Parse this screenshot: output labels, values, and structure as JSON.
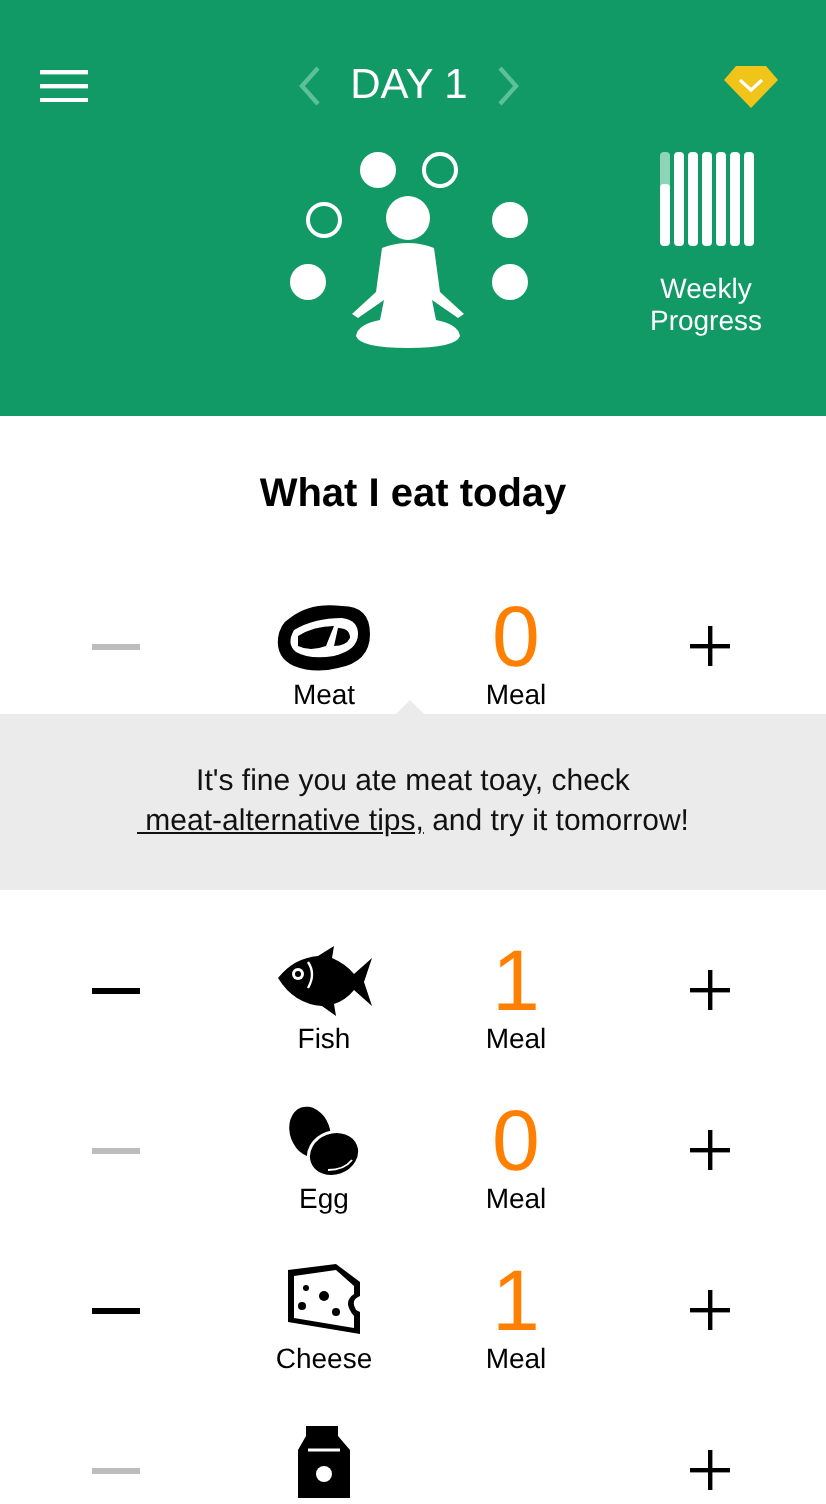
{
  "header": {
    "day": "DAY 1",
    "progress_label": "Weekly Progress",
    "meals": [
      {
        "filled": true
      },
      {
        "filled": false
      },
      {
        "filled": false
      },
      {
        "filled": true
      },
      {
        "filled": true
      },
      {
        "filled": true
      }
    ],
    "weekly_bars": [
      {
        "level": 0.66
      },
      {
        "level": 1
      },
      {
        "level": 1
      },
      {
        "level": 1
      },
      {
        "level": 1
      },
      {
        "level": 1
      },
      {
        "level": 1
      }
    ]
  },
  "title": "What I eat today",
  "foods": [
    {
      "kind": "meat",
      "name": "Meat",
      "count": "0",
      "unit": "Meal",
      "minus_disabled": true,
      "tip": {
        "before": "It's fine you ate meat toay, check",
        "link": " meat-alternative tips,",
        "after": " and try it tomorrow!"
      }
    },
    {
      "kind": "fish",
      "name": "Fish",
      "count": "1",
      "unit": "Meal",
      "minus_disabled": false
    },
    {
      "kind": "egg",
      "name": "Egg",
      "count": "0",
      "unit": "Meal",
      "minus_disabled": true
    },
    {
      "kind": "cheese",
      "name": "Cheese",
      "count": "1",
      "unit": "Meal",
      "minus_disabled": false
    },
    {
      "kind": "milk",
      "minus_disabled": true
    }
  ]
}
